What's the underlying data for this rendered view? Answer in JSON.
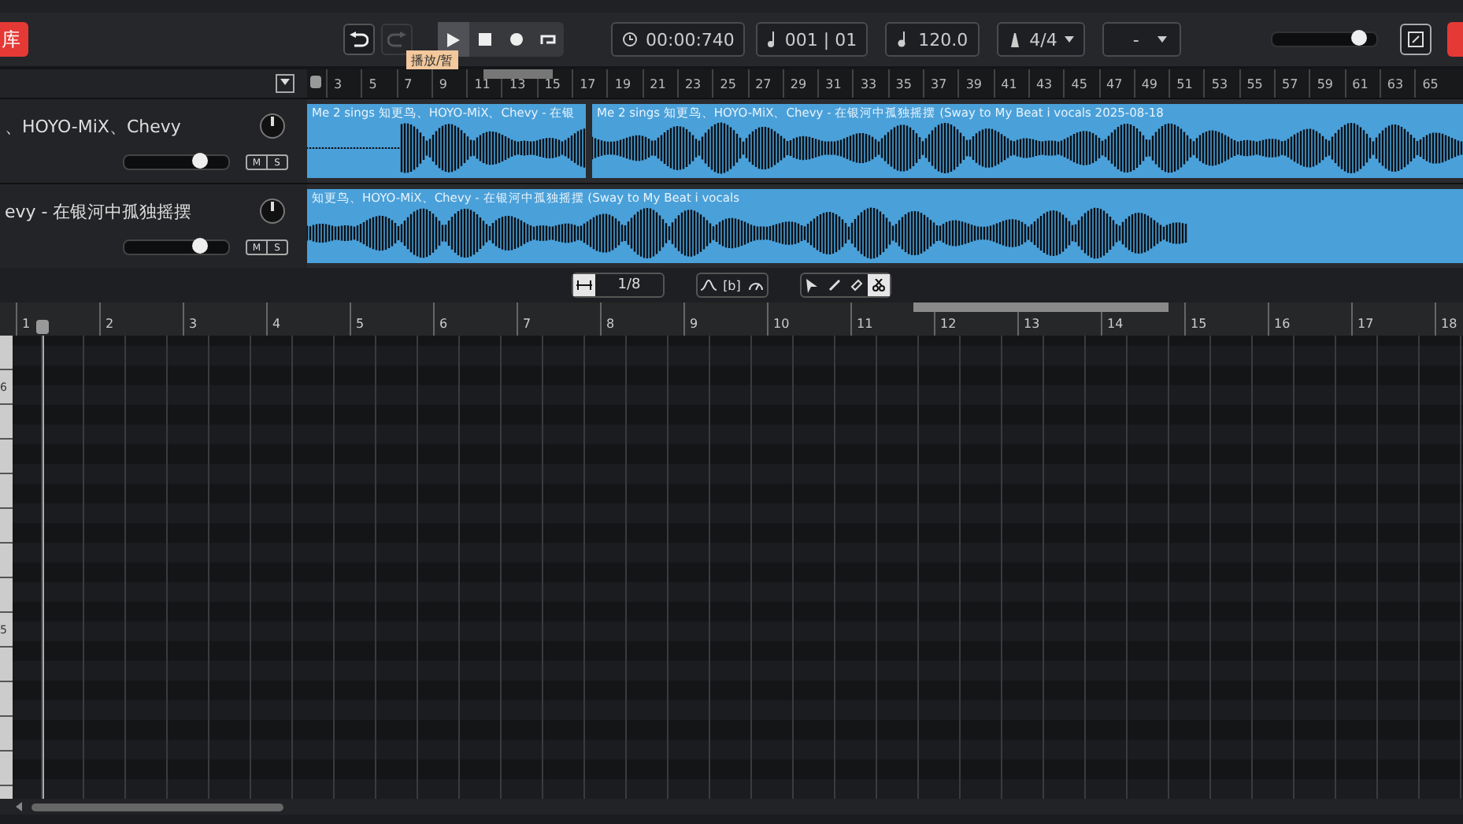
{
  "toolbar": {
    "library_button": "库",
    "transport": [
      {
        "kind": "play",
        "selected": true
      },
      {
        "kind": "stop",
        "selected": false
      },
      {
        "kind": "record",
        "selected": false
      },
      {
        "kind": "loop",
        "selected": false
      }
    ],
    "tooltip": "播放/暂",
    "time": "00:00:740",
    "position": "001 | 01",
    "tempo": "120.0",
    "time_signature": "4/4",
    "key": "-",
    "master_volume": {
      "level": 0.83
    }
  },
  "arrangement": {
    "ruler": [
      "3",
      "5",
      "7",
      "9",
      "11",
      "13",
      "15",
      "17",
      "19",
      "21",
      "23",
      "25",
      "27",
      "29",
      "31",
      "33",
      "35",
      "37",
      "39",
      "41",
      "43",
      "45",
      "47",
      "49",
      "51",
      "53",
      "55",
      "57",
      "59",
      "61",
      "63",
      "65"
    ],
    "tracks": [
      {
        "name": "、HOYO-MiX、Chevy",
        "level": 0.72,
        "mute": false,
        "solo": false,
        "mute_label": "M",
        "solo_label": "S",
        "clips": [
          "Me 2 sings 知更鸟、HOYO-MiX、Chevy - 在银",
          "Me 2 sings 知更鸟、HOYO-MiX、Chevy - 在银河中孤独摇摆 (Sway to My Beat i vocals 2025-08-18"
        ]
      },
      {
        "name": "evy - 在银河中孤独摇摆",
        "level": 0.72,
        "mute": false,
        "solo": false,
        "mute_label": "M",
        "solo_label": "S",
        "clips": [
          "知更鸟、HOYO-MiX、Chevy - 在银河中孤独摇摆 (Sway to My Beat i vocals"
        ]
      }
    ]
  },
  "piano_roll": {
    "snap_on": true,
    "quantize": "1/8",
    "bracket_label": "[b]",
    "tools": [
      {
        "kind": "pointer",
        "selected": false
      },
      {
        "kind": "pencil",
        "selected": false
      },
      {
        "kind": "eraser",
        "selected": false
      },
      {
        "kind": "scissors",
        "selected": true
      }
    ],
    "ruler": [
      "1",
      "2",
      "3",
      "4",
      "5",
      "6",
      "7",
      "8",
      "9",
      "10",
      "11",
      "12",
      "13",
      "14",
      "15",
      "16",
      "17",
      "18"
    ],
    "octave_labels": [
      "6",
      "5"
    ]
  }
}
